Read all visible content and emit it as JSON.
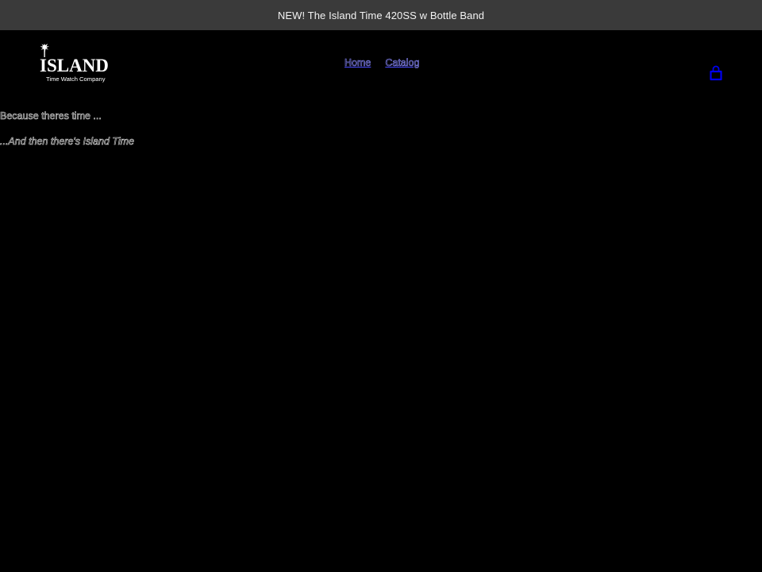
{
  "announcement": {
    "text": "NEW! The Island Time 420SS w Bottle Band"
  },
  "logo": {
    "wordmark": "ISLAND",
    "subtext": "Time Watch Company",
    "icon": "palm-tree-icon"
  },
  "nav": {
    "items": [
      {
        "label": "Home"
      },
      {
        "label": "Catalog"
      }
    ]
  },
  "cart": {
    "icon": "shopping-bag-icon",
    "color": "#0000ee"
  },
  "content": {
    "line1": "Because theres time ...",
    "line2": "...And then there's Island Time"
  },
  "colors": {
    "background": "#000000",
    "announcement_bg": "#3a3a3a",
    "link": "#8a8aff"
  }
}
